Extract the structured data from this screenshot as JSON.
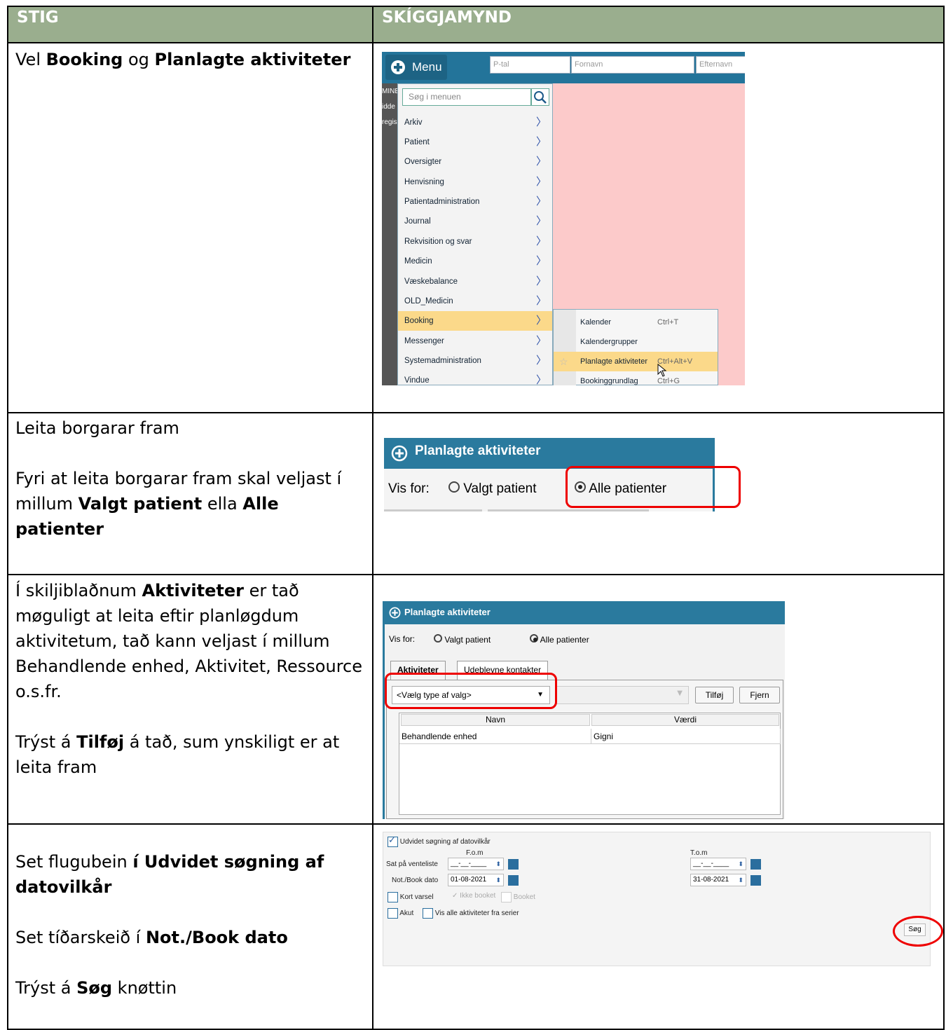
{
  "header": {
    "col1": "STIG",
    "col2": "SKÍGGJAMYND"
  },
  "rows": [
    {
      "p1": [
        "Vel ",
        "Booking",
        " og ",
        "Planlagte aktiviteter"
      ]
    },
    {
      "p1": "Leita borgarar fram",
      "p2": [
        "Fyri at leita borgarar fram skal veljast í millum ",
        "Valgt patient",
        " ella ",
        "Alle patienter"
      ]
    },
    {
      "p1": [
        "Í skiljiblaðnum ",
        "Aktiviteter",
        " er tað møguligt at leita eftir planløgdum aktivitetum, tað kann veljast í millum Behandlende enhed, Aktivitet, Ressource o.s.fr."
      ],
      "p2": [
        "Trýst á ",
        "Tilføj",
        " á tað, sum ynskiligt er at leita fram"
      ]
    },
    {
      "p1": [
        "Set flugubein ",
        "í Udvidet søgning af datovilkår"
      ],
      "p2": [
        "Set tíðarskeið í ",
        "Not./Book dato"
      ],
      "p3": [
        "Trýst á ",
        "Søg",
        " knøttin"
      ]
    }
  ],
  "shot1": {
    "menu_label": "Menu",
    "fields": [
      "P-tal",
      "Fornavn",
      "Efternavn"
    ],
    "left_fragments": [
      "MINE",
      "idde",
      "regis"
    ],
    "search_placeholder": "Søg i menuen",
    "items": [
      "Arkiv",
      "Patient",
      "Oversigter",
      "Henvisning",
      "Patientadministration",
      "Journal",
      "Rekvisition og svar",
      "Medicin",
      "Væskebalance",
      "OLD_Medicin",
      "Booking",
      "Messenger",
      "Systemadministration",
      "Vindue"
    ],
    "selected_item": "Booking",
    "submenu": [
      {
        "label": "Kalender",
        "shortcut": "Ctrl+T"
      },
      {
        "label": "Kalendergrupper",
        "shortcut": ""
      },
      {
        "label": "Planlagte aktiviteter",
        "shortcut": "Ctrl+Alt+V"
      },
      {
        "label": "Bookinggrundlag",
        "shortcut": "Ctrl+G"
      }
    ]
  },
  "shot2": {
    "title": "Planlagte aktiviteter",
    "vis_for": "Vis for:",
    "opt1": "Valgt patient",
    "opt2": "Alle patienter",
    "selected": "Alle patienter"
  },
  "shot3": {
    "title": "Planlagte aktiviteter",
    "vis_for": "Vis for:",
    "opt1": "Valgt patient",
    "opt2": "Alle patienter",
    "tab1": "Aktiviteter",
    "tab2": "Udeblevne kontakter",
    "select": "<Vælg type af valg>",
    "btn_add": "Tilføj",
    "btn_remove": "Fjern",
    "col_name": "Navn",
    "col_value": "Værdi",
    "row_name": "Behandlende enhed",
    "row_value": "Gigni"
  },
  "shot4": {
    "extended": "Udvidet søgning af datovilkår",
    "fom": "F.o.m",
    "tom": "T.o.m",
    "row1_label": "Sat på venteliste",
    "row1_from": "__-__-____",
    "row1_to": "__-__-____",
    "row2_label": "Not./Book dato",
    "row2_from": "01-08-2021",
    "row2_to": "31-08-2021",
    "kort": "Kort varsel",
    "ikke": "Ikke booket",
    "booket": "Booket",
    "akut": "Akut",
    "serier": "Vis alle aktiviteter fra serier",
    "search": "Søg"
  }
}
